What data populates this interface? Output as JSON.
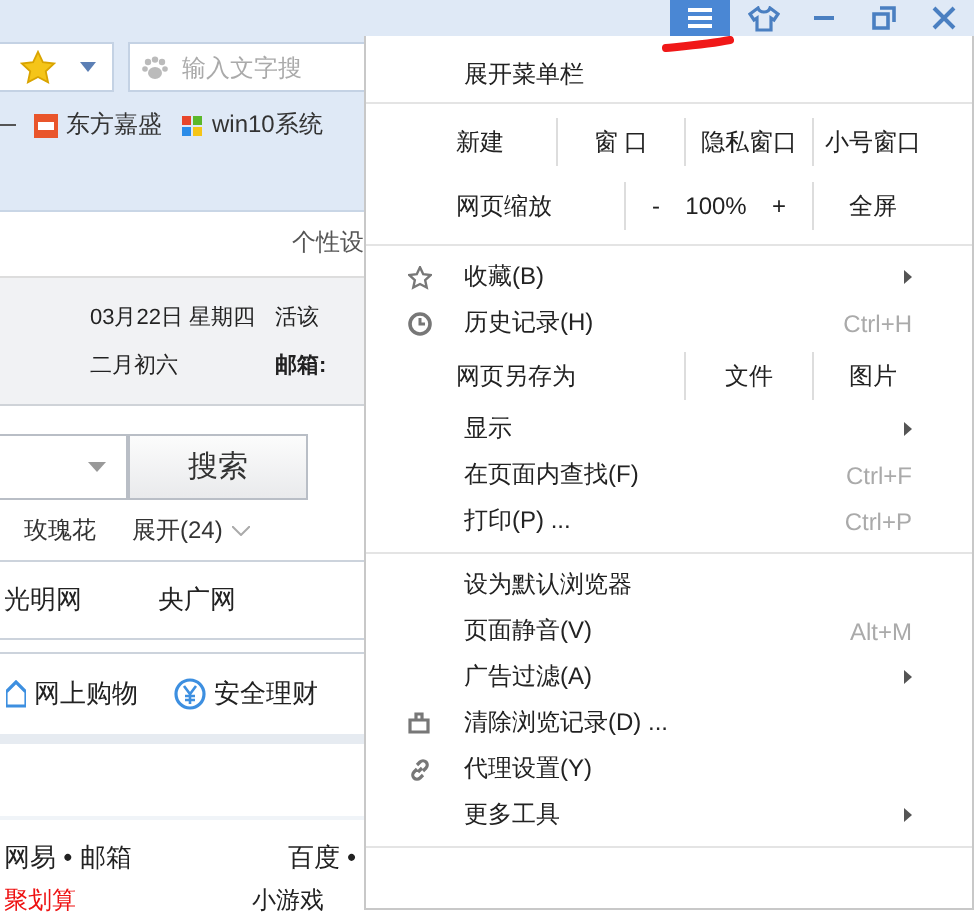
{
  "window_controls": [
    {
      "selected": true
    },
    {
      "selected": false
    },
    {
      "selected": false
    },
    {
      "selected": false
    },
    {
      "selected": false
    }
  ],
  "toolbar": {
    "search_placeholder": "输入文字搜",
    "bookmarks": [
      "东方嘉盛",
      "win10系统"
    ]
  },
  "page": {
    "settings_link": "个性设",
    "date": "03月22日 星期四",
    "lunar_date": "二月初六",
    "greeting": "活该",
    "mail_label": "邮箱:",
    "search_button": "搜索",
    "hot_word": "玫瑰花",
    "expand": "展开(24)",
    "sites": [
      "光明网",
      "央广网"
    ],
    "services": [
      "网上购物",
      "安全理财"
    ],
    "links_row": [
      "网易 • 邮箱",
      "百度 •"
    ],
    "bottom_row": [
      "聚划算",
      "小游戏"
    ]
  },
  "menu": {
    "sections": [
      [
        {
          "kind": "item",
          "label": "展开菜单栏",
          "submenu": false
        }
      ],
      [
        {
          "kind": "split",
          "label": "新建",
          "cells": [
            "窗 口",
            "隐私窗口",
            "小号窗口"
          ]
        },
        {
          "kind": "zoom",
          "label": "网页缩放",
          "zoom_out": "-",
          "zoom_value": "100%",
          "zoom_in": "+",
          "cells": [
            "全屏"
          ]
        }
      ],
      [
        {
          "kind": "item",
          "label": "收藏(B)",
          "submenu": true
        },
        {
          "kind": "item",
          "label": "历史记录(H)",
          "shortcut": "Ctrl+H",
          "submenu": false
        },
        {
          "kind": "split",
          "label": "网页另存为",
          "cells": [
            "文件",
            "图片"
          ]
        },
        {
          "kind": "item",
          "label": "显示",
          "submenu": true
        },
        {
          "kind": "item",
          "label": "在页面内查找(F)",
          "shortcut": "Ctrl+F",
          "submenu": false
        },
        {
          "kind": "item",
          "label": "打印(P) ...",
          "shortcut": "Ctrl+P",
          "submenu": false
        }
      ],
      [
        {
          "kind": "item",
          "label": "设为默认浏览器",
          "submenu": false
        },
        {
          "kind": "item",
          "label": "页面静音(V)",
          "shortcut": "Alt+M",
          "submenu": false
        },
        {
          "kind": "item",
          "label": "广告过滤(A)",
          "submenu": true
        },
        {
          "kind": "item",
          "label": "清除浏览记录(D) ...",
          "submenu": false
        },
        {
          "kind": "item",
          "label": "代理设置(Y)",
          "submenu": false
        },
        {
          "kind": "item",
          "label": "更多工具",
          "submenu": true
        }
      ]
    ]
  }
}
